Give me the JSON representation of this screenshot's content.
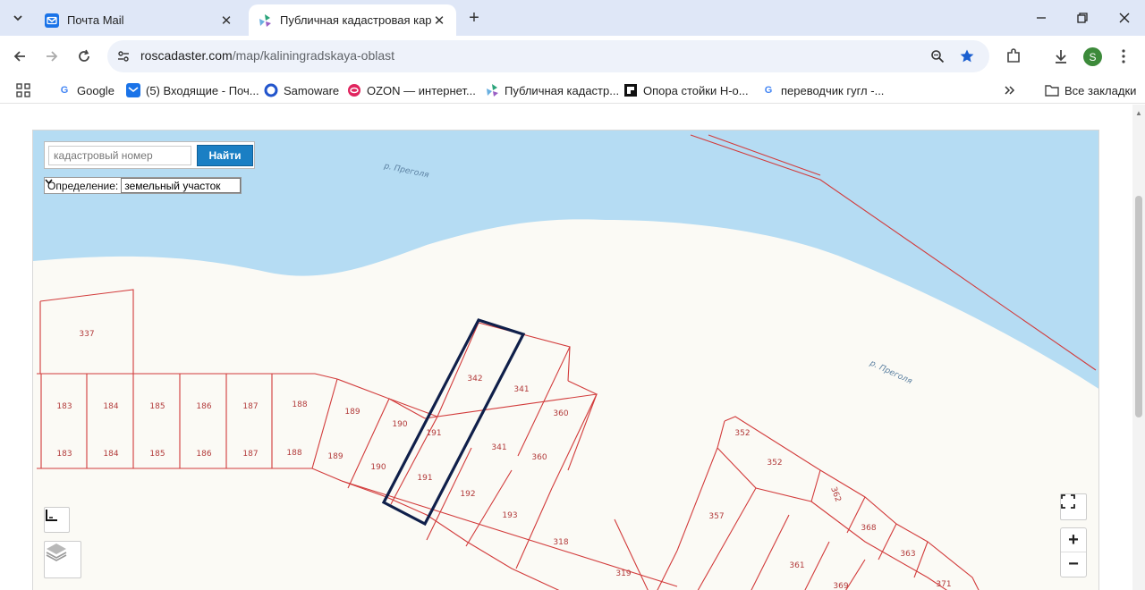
{
  "tabs": [
    {
      "title": "Почта Mail",
      "close": "✕"
    },
    {
      "title": "Публичная кадастровая карта",
      "close": "✕"
    }
  ],
  "toolbar": {
    "url_host": "roscadaster.com",
    "url_path": "/map/kaliningradskaya-oblast",
    "avatar_letter": "S"
  },
  "bookmarks": {
    "items": [
      "Google",
      "(5) Входящие - Поч...",
      "Samoware",
      "OZON — интернет...",
      "Публичная кадастр...",
      "Опора стойки Н-о...",
      "переводчик гугл -..."
    ],
    "all_label": "Все закладки"
  },
  "map": {
    "search_placeholder": "кадастровый номер",
    "search_button": "Найти",
    "definition_label": "Определение:",
    "definition_value": "земельный участок",
    "river_labels": [
      "р. Преголя",
      "р. Преголя"
    ],
    "parcel_numbers": [
      "337",
      "183",
      "183",
      "184",
      "184",
      "185",
      "185",
      "186",
      "186",
      "187",
      "187",
      "188",
      "188",
      "189",
      "189",
      "190",
      "190",
      "191",
      "191",
      "342",
      "341",
      "341",
      "360",
      "360",
      "192",
      "193",
      "318",
      "319",
      "357",
      "352",
      "352",
      "362",
      "368",
      "363",
      "361",
      "369",
      "371"
    ],
    "zoom_in": "+",
    "zoom_out": "−"
  },
  "icons": {
    "mail": "mail-icon",
    "cadastre": "cadastre-icon",
    "search": "search-icon",
    "star": "star-icon"
  },
  "colors": {
    "river": "#b5dcf3",
    "parcel_line": "#d23b3b",
    "selected": "#0f1f4a",
    "button": "#1a7fc4"
  }
}
